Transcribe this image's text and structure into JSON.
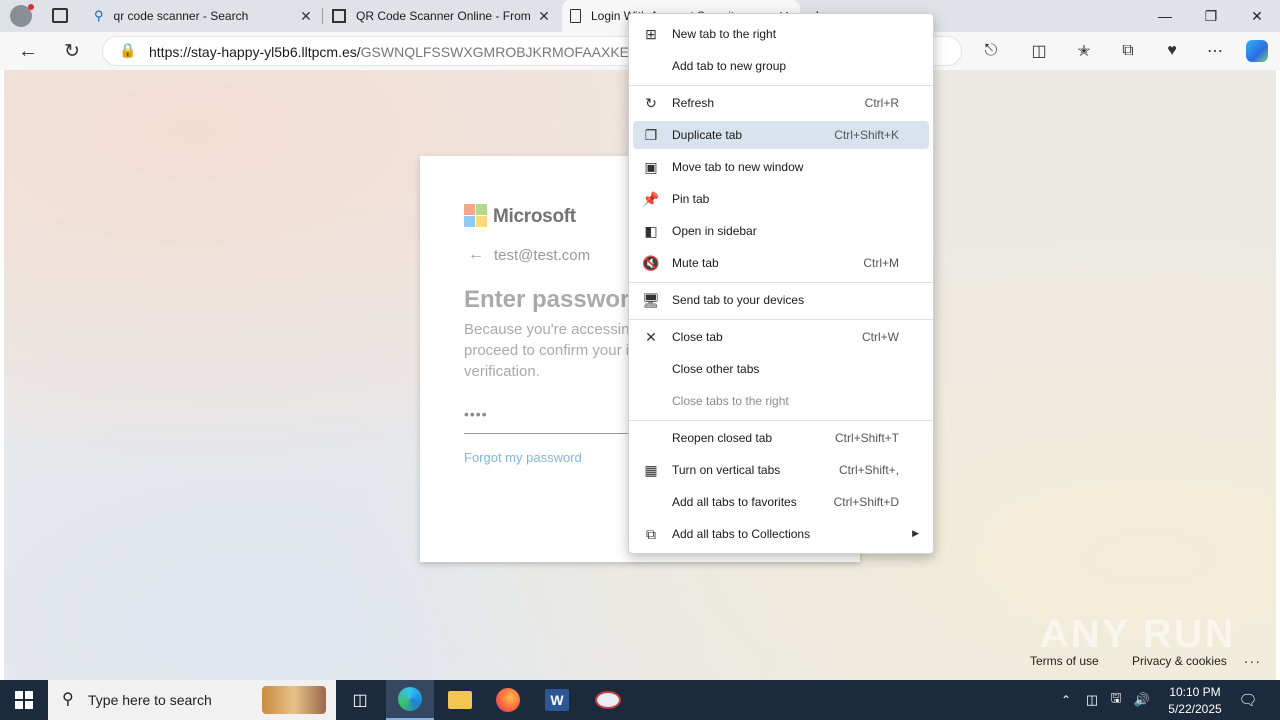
{
  "tabs": [
    {
      "title": "qr code scanner - Search",
      "icon": "search-icon"
    },
    {
      "title": "QR Code Scanner Online - From",
      "icon": "qr-scan-icon"
    },
    {
      "title": "Login With Account Security",
      "icon": "page-icon"
    }
  ],
  "address_bar": {
    "url_host": "https://stay-happy-yl5b6.lltpcm.es/",
    "url_path": "GSWNQLFSSWXGMROBJKRMOFAAXKEPM"
  },
  "login_card": {
    "brand": "Microsoft",
    "email": "test@test.com",
    "heading": "Enter password",
    "description": "Because you're accessing sensitive info, you need to proceed to confirm your identity in order to continue verification.",
    "password_mask": "••••",
    "forgot_link": "Forgot my password"
  },
  "footer": {
    "terms": "Terms of use",
    "privacy": "Privacy & cookies",
    "more": "..."
  },
  "watermark": "ANY RUN",
  "context_menu": [
    {
      "label": "New tab to the right",
      "shortcut": "",
      "icon": "new-tab-icon"
    },
    {
      "label": "Add tab to new group",
      "shortcut": "",
      "icon": ""
    },
    {
      "label": "Refresh",
      "shortcut": "Ctrl+R",
      "icon": "refresh-icon"
    },
    {
      "label": "Duplicate tab",
      "shortcut": "Ctrl+Shift+K",
      "icon": "duplicate-icon"
    },
    {
      "label": "Move tab to new window",
      "shortcut": "",
      "icon": "window-icon"
    },
    {
      "label": "Pin tab",
      "shortcut": "",
      "icon": "pin-icon"
    },
    {
      "label": "Open in sidebar",
      "shortcut": "",
      "icon": "sidebar-icon"
    },
    {
      "label": "Mute tab",
      "shortcut": "Ctrl+M",
      "icon": "mute-icon"
    },
    {
      "label": "Send tab to your devices",
      "shortcut": "",
      "icon": "devices-icon"
    },
    {
      "label": "Close tab",
      "shortcut": "Ctrl+W",
      "icon": "close-icon"
    },
    {
      "label": "Close other tabs",
      "shortcut": "",
      "icon": ""
    },
    {
      "label": "Close tabs to the right",
      "shortcut": "",
      "icon": ""
    },
    {
      "label": "Reopen closed tab",
      "shortcut": "Ctrl+Shift+T",
      "icon": ""
    },
    {
      "label": "Turn on vertical tabs",
      "shortcut": "Ctrl+Shift+,",
      "icon": "vertical-tabs-icon"
    },
    {
      "label": "Add all tabs to favorites",
      "shortcut": "Ctrl+Shift+D",
      "icon": ""
    },
    {
      "label": "Add all tabs to Collections",
      "shortcut": "",
      "icon": "collections-icon"
    }
  ],
  "taskbar": {
    "search_placeholder": "Type here to search",
    "time": "10:10 PM",
    "date": "5/22/2025"
  }
}
